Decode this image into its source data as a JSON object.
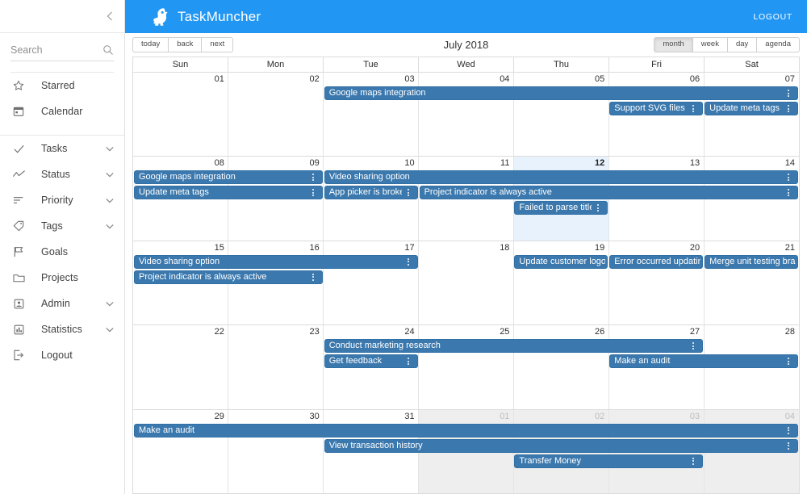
{
  "sidebar": {
    "collapse_icon": "chevron-left-icon",
    "search": {
      "placeholder": "Search",
      "value": "",
      "icon": "search-icon"
    },
    "items": [
      {
        "label": "Starred",
        "icon": "star-icon",
        "caret": false
      },
      {
        "label": "Calendar",
        "icon": "calendar-icon",
        "caret": false
      },
      {
        "label": "Tasks",
        "icon": "check-icon",
        "caret": true
      },
      {
        "label": "Status",
        "icon": "trend-icon",
        "caret": true
      },
      {
        "label": "Priority",
        "icon": "sort-icon",
        "caret": true
      },
      {
        "label": "Tags",
        "icon": "tag-icon",
        "caret": true
      },
      {
        "label": "Goals",
        "icon": "flag-icon",
        "caret": false
      },
      {
        "label": "Projects",
        "icon": "folder-icon",
        "caret": false
      },
      {
        "label": "Admin",
        "icon": "person-icon",
        "caret": true
      },
      {
        "label": "Statistics",
        "icon": "bar-chart-icon",
        "caret": true
      },
      {
        "label": "Logout",
        "icon": "exit-icon",
        "caret": false
      }
    ]
  },
  "header": {
    "brand": "TaskMuncher",
    "logo_icon": "bird-icon",
    "logout_label": "LOGOUT",
    "background_color": "#2196F3"
  },
  "toolbar": {
    "nav_buttons": [
      "today",
      "back",
      "next"
    ],
    "title": "July 2018",
    "view_buttons": [
      "month",
      "week",
      "day",
      "agenda"
    ],
    "active_view": "month"
  },
  "calendar": {
    "day_headers": [
      "Sun",
      "Mon",
      "Tue",
      "Wed",
      "Thu",
      "Fri",
      "Sat"
    ],
    "today_index": {
      "week": 1,
      "day": 4
    },
    "event_color": "#3b78ad",
    "today_color": "#e8f2fd",
    "offmonth_color": "#eeeeee",
    "weeks": [
      {
        "days": [
          {
            "num": "01",
            "off": false
          },
          {
            "num": "02",
            "off": false
          },
          {
            "num": "03",
            "off": false
          },
          {
            "num": "04",
            "off": false
          },
          {
            "num": "05",
            "off": false
          },
          {
            "num": "06",
            "off": false
          },
          {
            "num": "07",
            "off": false
          }
        ],
        "rows": [
          [
            {
              "title": "Google maps integration",
              "start": 2,
              "span": 5,
              "menu": true
            }
          ],
          [
            {
              "title": "Support SVG files",
              "start": 5,
              "span": 1,
              "menu": true
            },
            {
              "title": "Update meta tags",
              "start": 6,
              "span": 1,
              "menu": true
            }
          ]
        ]
      },
      {
        "days": [
          {
            "num": "08",
            "off": false
          },
          {
            "num": "09",
            "off": false
          },
          {
            "num": "10",
            "off": false
          },
          {
            "num": "11",
            "off": false
          },
          {
            "num": "12",
            "off": false,
            "today": true
          },
          {
            "num": "13",
            "off": false
          },
          {
            "num": "14",
            "off": false
          }
        ],
        "rows": [
          [
            {
              "title": "Google maps integration",
              "start": 0,
              "span": 2,
              "menu": true
            },
            {
              "title": "Video sharing option",
              "start": 2,
              "span": 5,
              "menu": true
            }
          ],
          [
            {
              "title": "Update meta tags",
              "start": 0,
              "span": 2,
              "menu": true
            },
            {
              "title": "App picker is broken",
              "start": 2,
              "span": 1,
              "menu": true
            },
            {
              "title": "Project indicator is always active",
              "start": 3,
              "span": 4,
              "menu": true
            }
          ],
          [
            {
              "title": "Failed to parse title",
              "start": 4,
              "span": 1,
              "menu": true
            }
          ]
        ]
      },
      {
        "days": [
          {
            "num": "15",
            "off": false
          },
          {
            "num": "16",
            "off": false
          },
          {
            "num": "17",
            "off": false
          },
          {
            "num": "18",
            "off": false
          },
          {
            "num": "19",
            "off": false
          },
          {
            "num": "20",
            "off": false
          },
          {
            "num": "21",
            "off": false
          }
        ],
        "rows": [
          [
            {
              "title": "Video sharing option",
              "start": 0,
              "span": 3,
              "menu": true
            },
            {
              "title": "Update customer logos",
              "start": 4,
              "span": 1,
              "menu": false
            },
            {
              "title": "Error occurred updating",
              "start": 5,
              "span": 1,
              "menu": false
            },
            {
              "title": "Merge unit testing branch",
              "start": 6,
              "span": 1,
              "menu": false
            }
          ],
          [
            {
              "title": "Project indicator is always active",
              "start": 0,
              "span": 2,
              "menu": true
            }
          ]
        ]
      },
      {
        "days": [
          {
            "num": "22",
            "off": false
          },
          {
            "num": "23",
            "off": false
          },
          {
            "num": "24",
            "off": false
          },
          {
            "num": "25",
            "off": false
          },
          {
            "num": "26",
            "off": false
          },
          {
            "num": "27",
            "off": false
          },
          {
            "num": "28",
            "off": false
          }
        ],
        "rows": [
          [
            {
              "title": "Conduct marketing research",
              "start": 2,
              "span": 4,
              "menu": true
            }
          ],
          [
            {
              "title": "Get feedback",
              "start": 2,
              "span": 1,
              "menu": true
            },
            {
              "title": "Make an audit",
              "start": 5,
              "span": 2,
              "menu": true
            }
          ]
        ]
      },
      {
        "days": [
          {
            "num": "29",
            "off": false
          },
          {
            "num": "30",
            "off": false
          },
          {
            "num": "31",
            "off": false
          },
          {
            "num": "01",
            "off": true
          },
          {
            "num": "02",
            "off": true
          },
          {
            "num": "03",
            "off": true
          },
          {
            "num": "04",
            "off": true
          }
        ],
        "rows": [
          [
            {
              "title": "Make an audit",
              "start": 0,
              "span": 7,
              "menu": true
            }
          ],
          [
            {
              "title": "View transaction history",
              "start": 2,
              "span": 5,
              "menu": true
            }
          ],
          [
            {
              "title": "Transfer Money",
              "start": 4,
              "span": 2,
              "menu": true
            }
          ]
        ]
      }
    ]
  }
}
